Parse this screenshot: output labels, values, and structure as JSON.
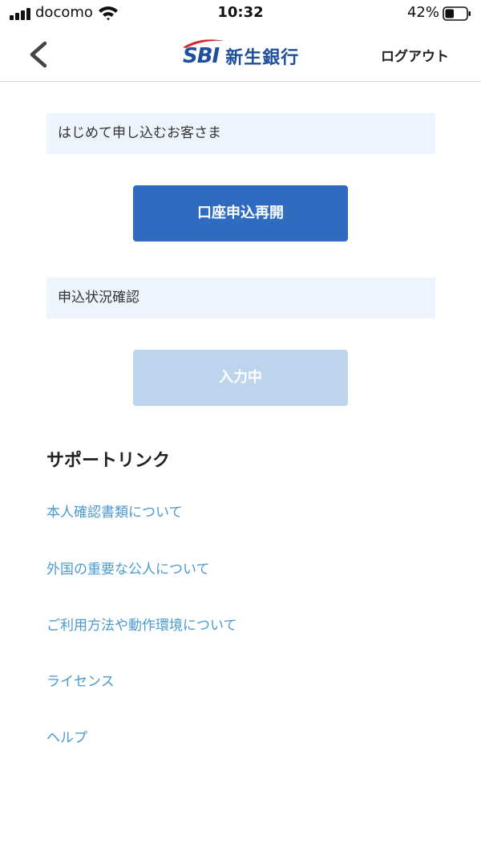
{
  "status_bar": {
    "carrier": "docomo",
    "time": "10:32",
    "battery_percent": "42%",
    "battery_level": 0.42
  },
  "nav": {
    "logo_mark": "SBI",
    "logo_name": "新生銀行",
    "logout_label": "ログアウト",
    "back_icon": "chevron-left-icon"
  },
  "new_customer": {
    "label": "はじめて申し込むお客さま",
    "button_label": "口座申込再開",
    "button_color": "#2f6bbe"
  },
  "application_status": {
    "label": "申込状況確認",
    "button_label": "入力中",
    "button_color": "#bcd5ec",
    "button_disabled": true
  },
  "support": {
    "heading": "サポートリンク",
    "links": [
      "本人確認書類について",
      "外国の重要な公人について",
      "ご利用方法や動作環境について",
      "ライセンス",
      "ヘルプ"
    ],
    "link_color": "#4a9ad0"
  }
}
